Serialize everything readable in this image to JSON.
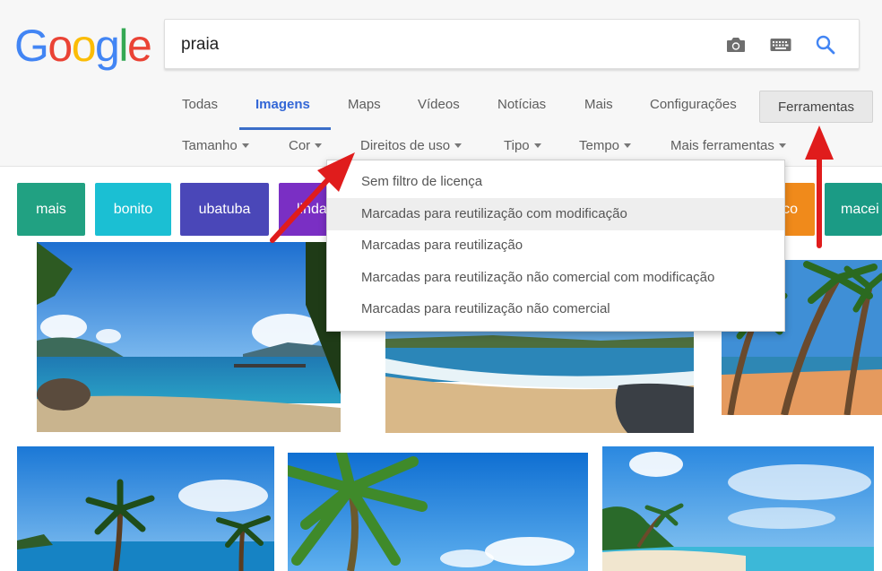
{
  "logo": {
    "letters": [
      "G",
      "o",
      "o",
      "g",
      "l",
      "e"
    ],
    "colors": [
      "#4285f4",
      "#ea4335",
      "#fbbc05",
      "#4285f4",
      "#34a853",
      "#ea4335"
    ]
  },
  "search": {
    "value": "praia"
  },
  "icons": {
    "camera": "camera-icon",
    "keyboard": "keyboard-icon",
    "search": "search-icon"
  },
  "tabs": [
    {
      "label": "Todas"
    },
    {
      "label": "Imagens",
      "active": true
    },
    {
      "label": "Maps"
    },
    {
      "label": "Vídeos"
    },
    {
      "label": "Notícias"
    },
    {
      "label": "Mais"
    },
    {
      "label": "Configurações"
    }
  ],
  "tools_button": "Ferramentas",
  "filters": [
    {
      "label": "Tamanho"
    },
    {
      "label": "Cor"
    },
    {
      "label": "Direitos de uso"
    },
    {
      "label": "Tipo"
    },
    {
      "label": "Tempo"
    },
    {
      "label": "Mais ferramentas"
    }
  ],
  "chips": [
    {
      "label": "mais",
      "color": "#21a182"
    },
    {
      "label": "bonito",
      "color": "#1bbfd3"
    },
    {
      "label": "ubatuba",
      "color": "#4a47b8"
    },
    {
      "label": "linda",
      "color": "#7a2fc4"
    },
    {
      "label": "co",
      "color": "#f08a1b"
    },
    {
      "label": "macei",
      "color": "#1b9b85"
    }
  ],
  "dropdown": {
    "items": [
      {
        "label": "Sem filtro de licença"
      },
      {
        "label": "Marcadas para reutilização com modificação",
        "highlighted": true
      },
      {
        "label": "Marcadas para reutilização"
      },
      {
        "label": "Marcadas para reutilização não comercial com modificação"
      },
      {
        "label": "Marcadas para reutilização não comercial"
      }
    ]
  },
  "colors": {
    "accent": "#3367d6",
    "arrow": "#e01c1c",
    "header_bg": "#f7f7f7"
  }
}
